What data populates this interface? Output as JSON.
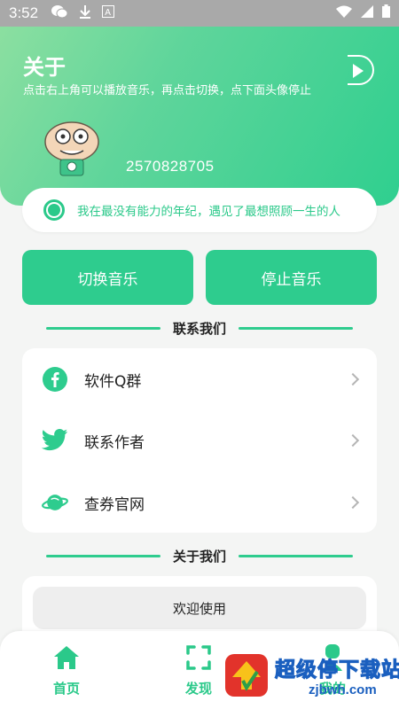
{
  "status_bar": {
    "time": "3:52",
    "icons": [
      "wechat-icon",
      "download-icon",
      "a-icon",
      "wifi-icon",
      "signal-icon",
      "battery-icon"
    ]
  },
  "header": {
    "title": "关于",
    "subtitle": "点击右上角可以播放音乐，再点击切换，点下面头像停止",
    "user_id": "2570828705"
  },
  "quote": {
    "text": "我在最没有能力的年纪，遇见了最想照顾一生的人"
  },
  "actions": {
    "switch_label": "切换音乐",
    "stop_label": "停止音乐"
  },
  "contact": {
    "heading": "联系我们",
    "items": [
      {
        "label": "软件Q群",
        "icon": "facebook-icon"
      },
      {
        "label": "联系作者",
        "icon": "twitter-icon"
      },
      {
        "label": "查券官网",
        "icon": "planet-icon"
      }
    ]
  },
  "about_us": {
    "heading": "关于我们",
    "welcome": "欢迎使用"
  },
  "nav": {
    "items": [
      {
        "label": "首页",
        "icon": "home-icon"
      },
      {
        "label": "发现",
        "icon": "scan-icon"
      },
      {
        "label": "我的",
        "icon": "user-icon"
      }
    ]
  },
  "watermark": {
    "title": "超级停下载站",
    "url": "zjbwh.com"
  },
  "colors": {
    "accent": "#2ecc8e",
    "header_gradient_start": "#8fe0a1",
    "header_gradient_end": "#2fcf8f",
    "status_bar": "#a9a9a9"
  }
}
